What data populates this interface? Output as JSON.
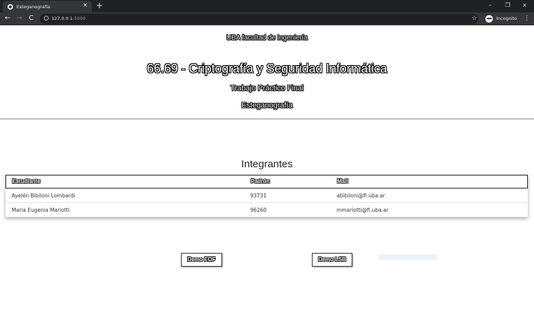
{
  "browser": {
    "tab_title": "Esteganografía",
    "tab_close": "×",
    "new_tab": "+",
    "window_controls": [
      "–",
      "❐",
      "×"
    ],
    "nav": {
      "back": "←",
      "forward": "→",
      "reload": "C"
    },
    "url_host": "127.0.0.1",
    "url_port": ":5000",
    "bookmark_star": "☆",
    "incognito_label": "Incognito",
    "menu": "⋮"
  },
  "header": {
    "faculty": "UBA facultad de ingeniería",
    "course": "66.69 - Criptografía y Seguridad Informática",
    "tp": "Trabajo Práctico Final",
    "subject": "Esteganografía"
  },
  "members": {
    "title": "Integrantes",
    "columns": [
      "Estudiante",
      "Padrón",
      "Mail"
    ],
    "rows": [
      [
        "Ayelén Bibiloni Lombardi",
        "93731",
        "abibiloni@fi.uba.ar"
      ],
      [
        "Maria Eugenia Mariotti",
        "96260",
        "mmariotti@fi.uba.ar"
      ]
    ]
  },
  "actions": {
    "demo_eof": "Demo EOF",
    "demo_lsb": "Demo LSB"
  }
}
